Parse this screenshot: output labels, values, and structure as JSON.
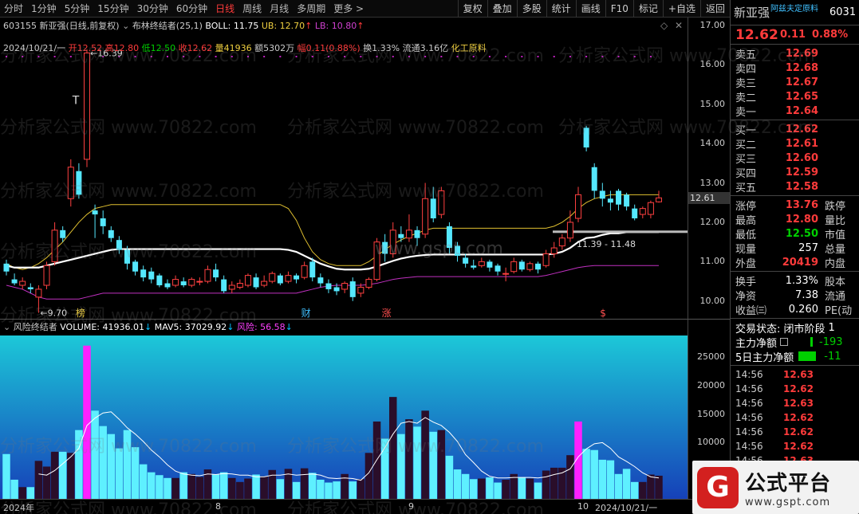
{
  "toolbar": {
    "periods": [
      "分时",
      "1分钟",
      "5分钟",
      "15分钟",
      "30分钟",
      "60分钟",
      "日线",
      "周线",
      "月线",
      "多周期",
      "更多 >"
    ],
    "active_index": 6,
    "right_buttons": [
      "复权",
      "叠加",
      "多股",
      "统计",
      "画线",
      "F10",
      "标记",
      "+自选",
      "返回"
    ]
  },
  "header": {
    "code": "603155",
    "name_mode": "新亚强(日线,前复权)",
    "indicator_name": "布林终结者(25,1)",
    "boll": "BOLL: 11.75",
    "ub": "UB: 12.70",
    "lb": "LB: 10.80"
  },
  "quote_line": {
    "date": "2024/10/21/一",
    "open": "开12.52",
    "high": "高12.80",
    "low": "低12.50",
    "close": "收12.62",
    "volume": "量41936",
    "amount": "额5302万",
    "change": "幅0.11(0.88%)",
    "turnover": "换1.33%",
    "float": "流通3.16亿",
    "sector": "化工原料"
  },
  "main_axis": {
    "labels": [
      "17.00",
      "16.00",
      "15.00",
      "14.00",
      "13.00",
      "12.00",
      "11.00",
      "10.00"
    ],
    "current": "12.61"
  },
  "annotations": {
    "high": "16.39",
    "low": "9.70",
    "range": "11.39 - 11.48",
    "tag_bang": "榜",
    "tag_cai": "财",
    "tag_zhang": "涨",
    "tag_s": "$",
    "t_mark": "T"
  },
  "volume_info": {
    "title": "风险终结者",
    "volume": "VOLUME: 41936.01",
    "mav5": "MAV5: 37029.92",
    "risk": "风险: 56.58"
  },
  "vol_axis": {
    "labels": [
      "25000",
      "20000",
      "15000",
      "10000",
      "5000"
    ]
  },
  "time_axis": {
    "labels": [
      "2024年",
      "8",
      "9",
      "10",
      "2024/10/21/一"
    ]
  },
  "watermarks": [
    "分析家公式网 www.70822.com",
    "www.gspt.com"
  ],
  "side": {
    "name": "新亚强",
    "sector_tag": "阿兹夫定原料",
    "code": "6031",
    "price": "12.62",
    "change": "0.11",
    "pct": "0.88%",
    "asks": [
      {
        "label": "卖五",
        "price": "12.69"
      },
      {
        "label": "卖四",
        "price": "12.68"
      },
      {
        "label": "卖三",
        "price": "12.67"
      },
      {
        "label": "卖二",
        "price": "12.65"
      },
      {
        "label": "卖一",
        "price": "12.64"
      }
    ],
    "bids": [
      {
        "label": "买一",
        "price": "12.62"
      },
      {
        "label": "买二",
        "price": "12.61"
      },
      {
        "label": "买三",
        "price": "12.60"
      },
      {
        "label": "买四",
        "price": "12.59"
      },
      {
        "label": "买五",
        "price": "12.58"
      }
    ],
    "stats": [
      {
        "label": "涨停",
        "value": "13.76",
        "color": "red",
        "r": "跌停"
      },
      {
        "label": "最高",
        "value": "12.80",
        "color": "red",
        "r": "量比"
      },
      {
        "label": "最低",
        "value": "12.50",
        "color": "green",
        "r": "市值"
      },
      {
        "label": "现量",
        "value": "257",
        "color": "white",
        "r": "总量"
      },
      {
        "label": "外盘",
        "value": "20419",
        "color": "red",
        "r": "内盘"
      }
    ],
    "stats2": [
      {
        "label": "换手",
        "value": "1.33%",
        "color": "white",
        "r": "股本"
      },
      {
        "label": "净资",
        "value": "7.38",
        "color": "white",
        "r": "流通"
      },
      {
        "label": "收益㈢",
        "value": "0.260",
        "color": "white",
        "r": "PE(动"
      }
    ],
    "trade_status": "交易状态: 闭市阶段",
    "trade_status_num": "1",
    "main_flow_label": "主力净额",
    "main_flow_value": "-193",
    "flow5_label": "5日主力净额",
    "flow5_value": "-11",
    "ticks": [
      {
        "time": "14:56",
        "price": "12.63"
      },
      {
        "time": "14:56",
        "price": "12.62"
      },
      {
        "time": "14:56",
        "price": "12.63"
      },
      {
        "time": "14:56",
        "price": "12.62"
      },
      {
        "time": "14:56",
        "price": "12.62"
      },
      {
        "time": "14:56",
        "price": "12.62"
      },
      {
        "time": "14:56",
        "price": "12.63"
      }
    ]
  },
  "logo": {
    "cn": "公式平台",
    "url": "www.gspt.com"
  },
  "chart_data": {
    "type": "candlestick",
    "ylim": [
      9.55,
      17.2
    ],
    "candles": [
      [
        10.95,
        10.75,
        11.05,
        10.65
      ],
      [
        10.55,
        10.45,
        10.7,
        10.4
      ],
      [
        10.4,
        10.5,
        10.6,
        10.3
      ],
      [
        10.35,
        10.3,
        10.45,
        10.2
      ],
      [
        10.1,
        10.3,
        10.4,
        9.7
      ],
      [
        10.4,
        10.9,
        11.0,
        10.3
      ],
      [
        11.0,
        11.8,
        12.0,
        10.9
      ],
      [
        11.8,
        11.6,
        11.9,
        11.5
      ],
      [
        12.6,
        13.4,
        13.6,
        12.4
      ],
      [
        13.3,
        12.7,
        13.5,
        12.6
      ],
      [
        13.6,
        16.3,
        16.39,
        13.4
      ],
      [
        12.3,
        12.2,
        12.45,
        11.6
      ],
      [
        12.1,
        11.9,
        12.3,
        11.7
      ],
      [
        11.8,
        11.6,
        11.9,
        11.5
      ],
      [
        11.55,
        11.3,
        11.65,
        11.2
      ],
      [
        11.3,
        10.95,
        11.4,
        10.8
      ],
      [
        11.0,
        10.75,
        11.05,
        10.65
      ],
      [
        10.8,
        10.6,
        10.9,
        10.5
      ],
      [
        10.75,
        10.55,
        10.85,
        10.45
      ],
      [
        10.65,
        10.4,
        10.7,
        10.35
      ],
      [
        10.45,
        10.35,
        10.55,
        10.3
      ],
      [
        10.4,
        10.55,
        10.65,
        10.35
      ],
      [
        10.5,
        10.4,
        10.6,
        10.35
      ],
      [
        10.4,
        10.55,
        10.6,
        10.35
      ],
      [
        10.5,
        10.5,
        10.6,
        10.4
      ],
      [
        10.5,
        10.8,
        10.9,
        10.45
      ],
      [
        10.8,
        10.6,
        10.95,
        10.5
      ],
      [
        10.55,
        10.25,
        10.65,
        10.2
      ],
      [
        10.3,
        10.4,
        10.5,
        10.2
      ],
      [
        10.35,
        10.45,
        10.55,
        10.3
      ],
      [
        10.4,
        10.65,
        10.7,
        10.35
      ],
      [
        10.6,
        10.35,
        10.7,
        10.3
      ],
      [
        10.4,
        10.5,
        10.65,
        10.35
      ],
      [
        10.5,
        10.7,
        10.75,
        10.45
      ],
      [
        10.65,
        10.45,
        10.7,
        10.4
      ],
      [
        10.5,
        10.65,
        10.75,
        10.45
      ],
      [
        10.65,
        10.55,
        10.7,
        10.45
      ],
      [
        10.6,
        10.9,
        11.0,
        10.55
      ],
      [
        11.0,
        10.6,
        11.1,
        10.5
      ],
      [
        10.6,
        10.45,
        10.7,
        10.35
      ],
      [
        10.45,
        10.3,
        10.55,
        10.2
      ],
      [
        10.35,
        10.25,
        10.45,
        10.15
      ],
      [
        10.3,
        10.45,
        10.5,
        10.2
      ],
      [
        10.5,
        10.1,
        10.6,
        10.0
      ],
      [
        10.2,
        10.35,
        10.45,
        10.1
      ],
      [
        10.35,
        10.55,
        10.6,
        10.3
      ],
      [
        10.55,
        11.5,
        11.6,
        10.5
      ],
      [
        11.5,
        11.2,
        11.7,
        11.0
      ],
      [
        11.2,
        11.8,
        12.0,
        11.1
      ],
      [
        11.7,
        11.6,
        11.9,
        11.5
      ],
      [
        11.6,
        11.8,
        12.2,
        11.5
      ],
      [
        11.8,
        11.6,
        11.9,
        11.4
      ],
      [
        11.7,
        12.6,
        13.0,
        11.6
      ],
      [
        12.6,
        12.1,
        12.9,
        12.0
      ],
      [
        12.2,
        12.8,
        12.9,
        12.1
      ],
      [
        11.9,
        11.35,
        12.0,
        11.2
      ],
      [
        11.4,
        11.15,
        11.5,
        11.0
      ],
      [
        11.1,
        10.95,
        11.2,
        10.85
      ],
      [
        10.9,
        10.85,
        11.05,
        10.8
      ],
      [
        10.9,
        11.0,
        11.1,
        10.85
      ],
      [
        11.0,
        10.85,
        11.05,
        10.75
      ],
      [
        10.9,
        10.75,
        10.95,
        10.65
      ],
      [
        10.7,
        10.7,
        10.85,
        10.5
      ],
      [
        10.75,
        11.0,
        11.1,
        10.7
      ],
      [
        11.0,
        10.8,
        11.05,
        10.75
      ],
      [
        10.8,
        10.95,
        11.0,
        10.75
      ],
      [
        10.95,
        10.8,
        11.0,
        10.7
      ],
      [
        10.9,
        11.2,
        11.3,
        10.85
      ],
      [
        11.2,
        11.35,
        11.5,
        11.1
      ],
      [
        11.4,
        11.6,
        11.7,
        11.3
      ],
      [
        11.6,
        12.0,
        12.3,
        11.5
      ],
      [
        12.1,
        12.7,
        12.9,
        12.0
      ],
      [
        14.4,
        13.9,
        14.45,
        13.8
      ],
      [
        13.4,
        12.8,
        13.5,
        12.6
      ],
      [
        12.8,
        12.6,
        13.0,
        12.4
      ],
      [
        12.6,
        12.5,
        12.8,
        12.3
      ],
      [
        12.8,
        12.45,
        12.85,
        12.3
      ],
      [
        12.7,
        12.4,
        12.75,
        12.3
      ],
      [
        12.35,
        12.1,
        12.45,
        12.05
      ],
      [
        12.2,
        12.35,
        12.4,
        12.1
      ],
      [
        12.2,
        12.5,
        12.55,
        12.1
      ],
      [
        12.52,
        12.62,
        12.8,
        12.5
      ]
    ],
    "mid": [
      10.9,
      10.85,
      10.85,
      10.85,
      10.85,
      10.9,
      10.95,
      11.0,
      11.05,
      11.1,
      11.15,
      11.2,
      11.25,
      11.3,
      11.32,
      11.32,
      11.32,
      11.32,
      11.32,
      11.32,
      11.32,
      11.32,
      11.32,
      11.32,
      11.32,
      11.32,
      11.32,
      11.32,
      11.32,
      11.32,
      11.32,
      11.32,
      11.32,
      11.32,
      11.32,
      11.3,
      11.25,
      11.15,
      11.05,
      10.95,
      10.88,
      10.82,
      10.8,
      10.8,
      10.8,
      10.82,
      10.88,
      10.95,
      11.02,
      11.08,
      11.12,
      11.15,
      11.17,
      11.18,
      11.18,
      11.18,
      11.18,
      11.18,
      11.18,
      11.18,
      11.18,
      11.18,
      11.18,
      11.18,
      11.18,
      11.18,
      11.18,
      11.18,
      11.2,
      11.25,
      11.35,
      11.5,
      11.6,
      11.62,
      11.68,
      11.72,
      11.72,
      11.75,
      11.75,
      11.75,
      11.75,
      11.75
    ],
    "upper": [
      10.95,
      10.85,
      10.8,
      10.85,
      10.95,
      11.1,
      11.3,
      11.5,
      11.75,
      12.0,
      12.2,
      12.35,
      12.4,
      12.45,
      12.45,
      12.45,
      12.45,
      12.45,
      12.45,
      12.45,
      12.45,
      12.45,
      12.45,
      12.45,
      12.45,
      12.45,
      12.45,
      12.45,
      12.45,
      12.45,
      12.45,
      12.45,
      12.45,
      12.45,
      12.45,
      12.35,
      12.05,
      11.6,
      11.25,
      11.05,
      10.95,
      10.9,
      10.9,
      10.9,
      10.9,
      11.0,
      11.15,
      11.3,
      11.45,
      11.55,
      11.65,
      11.72,
      11.8,
      11.85,
      11.85,
      11.85,
      11.85,
      11.85,
      11.85,
      11.85,
      11.85,
      11.85,
      11.85,
      11.85,
      11.85,
      11.85,
      11.85,
      11.85,
      11.9,
      12.0,
      12.15,
      12.35,
      12.5,
      12.6,
      12.65,
      12.7,
      12.7,
      12.7,
      12.7,
      12.7,
      12.7,
      12.7
    ],
    "lower": [
      10.4,
      10.35,
      10.3,
      10.2,
      10.1,
      10.05,
      10.05,
      10.05,
      10.05,
      10.05,
      10.1,
      10.15,
      10.2,
      10.2,
      10.2,
      10.2,
      10.2,
      10.2,
      10.2,
      10.2,
      10.2,
      10.2,
      10.2,
      10.2,
      10.2,
      10.2,
      10.2,
      10.2,
      10.2,
      10.2,
      10.2,
      10.2,
      10.2,
      10.2,
      10.2,
      10.2,
      10.2,
      10.25,
      10.3,
      10.35,
      10.38,
      10.4,
      10.4,
      10.4,
      10.4,
      10.42,
      10.45,
      10.5,
      10.55,
      10.58,
      10.6,
      10.62,
      10.62,
      10.62,
      10.62,
      10.62,
      10.62,
      10.62,
      10.62,
      10.62,
      10.62,
      10.62,
      10.62,
      10.62,
      10.62,
      10.62,
      10.62,
      10.65,
      10.7,
      10.75,
      10.8,
      10.85,
      10.88,
      10.9,
      10.9,
      10.9,
      10.9,
      10.9,
      10.9,
      10.9,
      10.9,
      10.9
    ],
    "volume": [
      8000,
      3500,
      2200,
      2200,
      6800,
      5800,
      8400,
      8400,
      8200,
      12200,
      27000,
      15600,
      12900,
      11500,
      9000,
      12200,
      9200,
      6200,
      4800,
      4300,
      3800,
      3800,
      4800,
      4500,
      4000,
      5300,
      4400,
      4800,
      3800,
      3100,
      3700,
      4400,
      4100,
      5200,
      3600,
      5400,
      3100,
      5500,
      4700,
      3500,
      3000,
      3200,
      4500,
      3200,
      3600,
      8200,
      13700,
      10700,
      18000,
      11500,
      14100,
      12800,
      15600,
      11900,
      12200,
      7700,
      5300,
      4500,
      3600,
      3700,
      3900,
      3000,
      3500,
      4500,
      3900,
      3700,
      3000,
      5100,
      5600,
      5600,
      7800,
      13700,
      8900,
      8700,
      7000,
      6900,
      4500,
      5400,
      3100,
      3100,
      4400,
      4200
    ],
    "mav5": [
      null,
      null,
      null,
      null,
      4500,
      4300,
      5100,
      6300,
      7500,
      9000,
      13000,
      14300,
      15200,
      15400,
      14100,
      12600,
      11500,
      10200,
      8700,
      7500,
      6100,
      5000,
      4500,
      4300,
      4200,
      4500,
      4400,
      4600,
      4500,
      4300,
      4300,
      4000,
      4000,
      4300,
      4300,
      4500,
      4300,
      4400,
      4500,
      4300,
      3800,
      3700,
      3800,
      3700,
      3400,
      4700,
      7000,
      9100,
      11500,
      13400,
      13700,
      13400,
      14400,
      13600,
      13000,
      11800,
      10200,
      7900,
      6500,
      5000,
      4100,
      3800,
      3800,
      3900,
      3900,
      3900,
      3800,
      4000,
      4400,
      4700,
      5400,
      7500,
      8900,
      9800,
      10000,
      9000,
      7500,
      6700,
      5800,
      4700,
      4000,
      3800
    ]
  }
}
